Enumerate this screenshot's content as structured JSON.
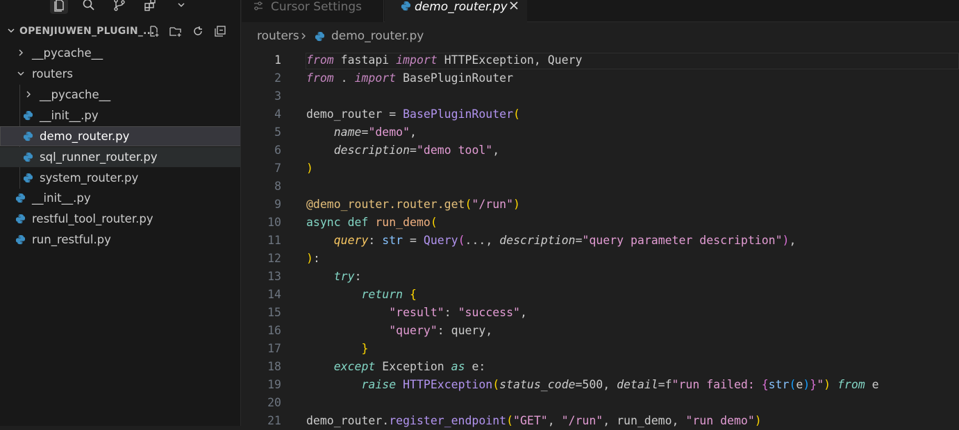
{
  "explorer": {
    "title": "OPENJIUWEN_PLUGIN_...",
    "tree": [
      {
        "label": "__pycache__",
        "type": "folder",
        "expanded": false,
        "depth": 1
      },
      {
        "label": "routers",
        "type": "folder",
        "expanded": true,
        "depth": 1
      },
      {
        "label": "__pycache__",
        "type": "folder",
        "expanded": false,
        "depth": 2
      },
      {
        "label": "__init__.py",
        "type": "python",
        "depth": 2
      },
      {
        "label": "demo_router.py",
        "type": "python",
        "depth": 2,
        "selected": true
      },
      {
        "label": "sql_runner_router.py",
        "type": "python",
        "depth": 2
      },
      {
        "label": "system_router.py",
        "type": "python",
        "depth": 2
      },
      {
        "label": "__init__.py",
        "type": "python",
        "depth": 1
      },
      {
        "label": "restful_tool_router.py",
        "type": "python",
        "depth": 1
      },
      {
        "label": "run_restful.py",
        "type": "python",
        "depth": 1
      }
    ]
  },
  "tabs": [
    {
      "label": "Cursor Settings",
      "active": false,
      "icon": "settings-sliders-icon"
    },
    {
      "label": "demo_router.py",
      "active": true,
      "icon": "python-icon"
    }
  ],
  "breadcrumb": {
    "folder": "routers",
    "file": "demo_router.py"
  },
  "editor": {
    "current_line": 1,
    "lines": [
      {
        "n": "1"
      },
      {
        "n": "2"
      },
      {
        "n": "3"
      },
      {
        "n": "4"
      },
      {
        "n": "5"
      },
      {
        "n": "6"
      },
      {
        "n": "7"
      },
      {
        "n": "8"
      },
      {
        "n": "9"
      },
      {
        "n": "10"
      },
      {
        "n": "11"
      },
      {
        "n": "12"
      },
      {
        "n": "13"
      },
      {
        "n": "14"
      },
      {
        "n": "15"
      },
      {
        "n": "16"
      },
      {
        "n": "17"
      },
      {
        "n": "18"
      },
      {
        "n": "19"
      },
      {
        "n": "20"
      },
      {
        "n": "21"
      }
    ],
    "code": [
      "from fastapi import HTTPException, Query",
      "from . import BasePluginRouter",
      "",
      "demo_router = BasePluginRouter(",
      "    name=\"demo\",",
      "    description=\"demo tool\",",
      ")",
      "",
      "@demo_router.router.get(\"/run\")",
      "async def run_demo(",
      "    query: str = Query(..., description=\"query parameter description\"),",
      "):",
      "    try:",
      "        return {",
      "            \"result\": \"success\",",
      "            \"query\": query,",
      "        }",
      "    except Exception as e:",
      "        raise HTTPException(status_code=500, detail=f\"run failed: {str(e)}\") from e",
      "",
      "demo_router.register_endpoint(\"GET\", \"/run\", run_demo, \"run demo\")"
    ]
  },
  "colors": {
    "editor_bg": "#1f1f1f",
    "sidebar_bg": "#181818",
    "python_icon": "#3b8fc4",
    "keyword": "#569cd6",
    "string": "#ce9178",
    "function": "#dcdcaa",
    "class": "#4ec9b0"
  }
}
